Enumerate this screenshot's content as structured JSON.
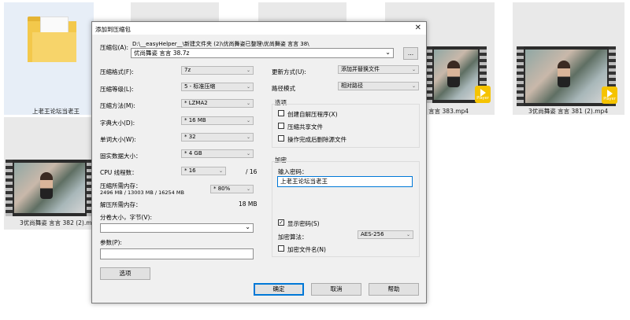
{
  "background": {
    "tiles": [
      {
        "label": "上老王论坛当老王"
      },
      {
        "label": "3优尚舞姿 言言 383.mp4"
      },
      {
        "label": "3优尚舞姿 言言 381 (2).mp4"
      },
      {
        "label": "3优尚舞姿 言言 382 (2).mp4"
      }
    ],
    "player_badge": "Player"
  },
  "dialog": {
    "title": "添加到压缩包",
    "close_symbol": "✕",
    "archive_label": "压缩包(A):",
    "archive_path": "D:\\__easyHelper__\\新建文件夹 (2)\\优尚舞姿已整理\\优尚舞姿 言言 38\\",
    "archive_name": "优尚舞姿 言言 38.7z",
    "browse_label": "...",
    "format_label": "压缩格式(F):",
    "format_value": "7z",
    "level_label": "压缩等级(L):",
    "level_value": "5 - 标准压缩",
    "method_label": "压缩方法(M):",
    "method_value": "* LZMA2",
    "dict_label": "字典大小(D):",
    "dict_value": "* 16 MB",
    "word_label": "单词大小(W):",
    "word_value": "* 32",
    "solid_label": "固实数据大小：",
    "solid_value": "* 4 GB",
    "threads_label": "CPU 线程数：",
    "threads_value": "* 16",
    "threads_max": "/ 16",
    "mem_comp_label": "压缩所需内存：",
    "mem_comp_detail": "2496 MB / 13003 MB / 16254 MB",
    "mem_comp_value": "* 80%",
    "mem_decomp_label": "解压所需内存：",
    "mem_decomp_value": "18 MB",
    "split_label": "分卷大小，字节(V):",
    "split_value": "",
    "params_label": "参数(P):",
    "params_value": "",
    "options_button": "选项",
    "update_label": "更新方式(U):",
    "update_value": "添加并替换文件",
    "path_mode_label": "路径模式",
    "path_mode_value": "相对路径",
    "options_group_title": "选项",
    "opt_sfx": "创建自解压程序(X)",
    "opt_shared": "压缩共享文件",
    "opt_delete": "操作完成后删除源文件",
    "encrypt_group_title": "加密",
    "password_label": "输入密码：",
    "password_value": "上老王论坛当老王",
    "show_password_label": "显示密码(S)",
    "show_password_check": "✓",
    "enc_method_label": "加密算法：",
    "enc_method_value": "AES-256",
    "encrypt_names_label": "加密文件名(N)",
    "ok_button": "确定",
    "cancel_button": "取消",
    "help_button": "帮助",
    "dropdown_arrow": "⌄"
  },
  "colors": {
    "accent": "#0078d7",
    "player_badge": "#f5c300",
    "folder": "#f3c84b"
  }
}
